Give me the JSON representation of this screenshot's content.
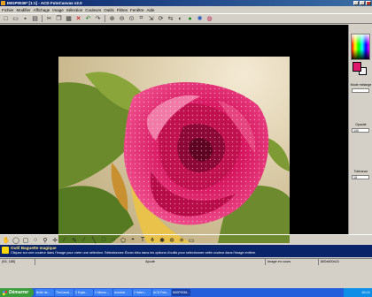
{
  "window": {
    "title": "IMGP0036* [1:1] - ACD FotoCanvas v2.0"
  },
  "menu": [
    "Fichier",
    "Modifier",
    "Affichage",
    "Image",
    "Sélection",
    "Couleurs",
    "Outils",
    "Filtres",
    "Fenêtre",
    "Aide"
  ],
  "toolbar_icons": [
    "new-icon",
    "open-icon",
    "save-icon",
    "print-icon",
    "cut-icon",
    "copy-icon",
    "paste-icon",
    "delete-icon",
    "undo-icon",
    "redo-icon",
    "zoom-in-icon",
    "zoom-out-icon",
    "zoom-fit-icon",
    "crop-icon",
    "resize-icon",
    "rotate-icon",
    "flip-icon",
    "brightness-icon",
    "color-icon",
    "effects-icon",
    "layers-icon"
  ],
  "side": {
    "mode_label": "Mode mélange",
    "opacity_label": "Opacité",
    "opacity_value": "100",
    "tolerance_label": "Tolérance",
    "tolerance_value": "15"
  },
  "colors": {
    "foreground": "#e0186c",
    "background": "#f4f4f4",
    "accent": "#0a246a"
  },
  "tools": [
    "hand-tool",
    "lasso-tool",
    "select-rect-tool",
    "select-ellipse-tool",
    "magic-wand-tool",
    "move-tool",
    "eyedropper-tool",
    "pencil-tool",
    "brush-tool",
    "line-tool",
    "rect-tool",
    "ellipse-tool",
    "polygon-tool",
    "fill-tool",
    "text-tool",
    "clone-tool",
    "retouch-tool",
    "blur-tool",
    "sharpen-tool",
    "eraser-tool"
  ],
  "hint": {
    "title": "Outil Baguette magique",
    "text": "Cliquez sur une couleur dans l'image pour créer une sélection. Sélectionnez Écran bleu dans les options d'outils pour sélectionner cette couleur dans l'image entière."
  },
  "status": {
    "coords": "(93, 185)",
    "mode": "Ajouté",
    "info": "Image en cours",
    "size": "800x600x24"
  },
  "taskbar": {
    "start_label": "Démarrer",
    "tasks": [
      "Boîte de...",
      "TheCanal...",
      "2 Explo...",
      "2 Micros...",
      "Acrobat...",
      "2 Intern...",
      "ACD Foto...",
      "IMGP0036..."
    ],
    "clock": "15:21"
  }
}
